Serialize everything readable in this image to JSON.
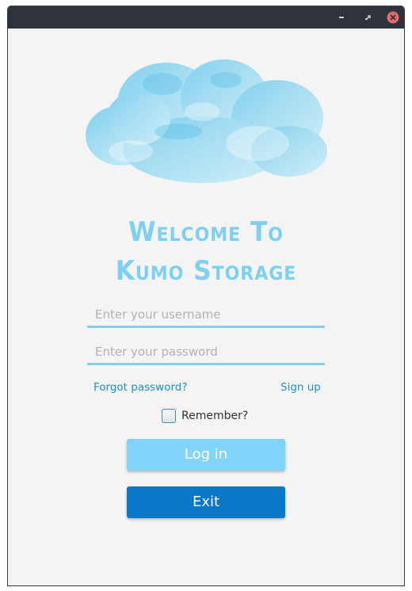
{
  "window": {
    "controls": {
      "minimize": "minimize-icon",
      "maximize": "maximize-icon",
      "close": "close-icon"
    }
  },
  "logo": {
    "icon": "cloud-icon",
    "color": "#7fcff2"
  },
  "title": {
    "line1": "Welcome To",
    "line2": "Kumo Storage"
  },
  "form": {
    "username_placeholder": "Enter your username",
    "username_value": "",
    "password_placeholder": "Enter your password",
    "password_value": ""
  },
  "links": {
    "forgot": "Forgot password?",
    "signup": "Sign up"
  },
  "remember": {
    "label": "Remember?",
    "checked": false
  },
  "buttons": {
    "login": "Log in",
    "exit": "Exit"
  },
  "colors": {
    "accent": "#7fcff2",
    "login_button": "#82d3fb",
    "exit_button": "#0a78c6",
    "link": "#1a92c6"
  }
}
